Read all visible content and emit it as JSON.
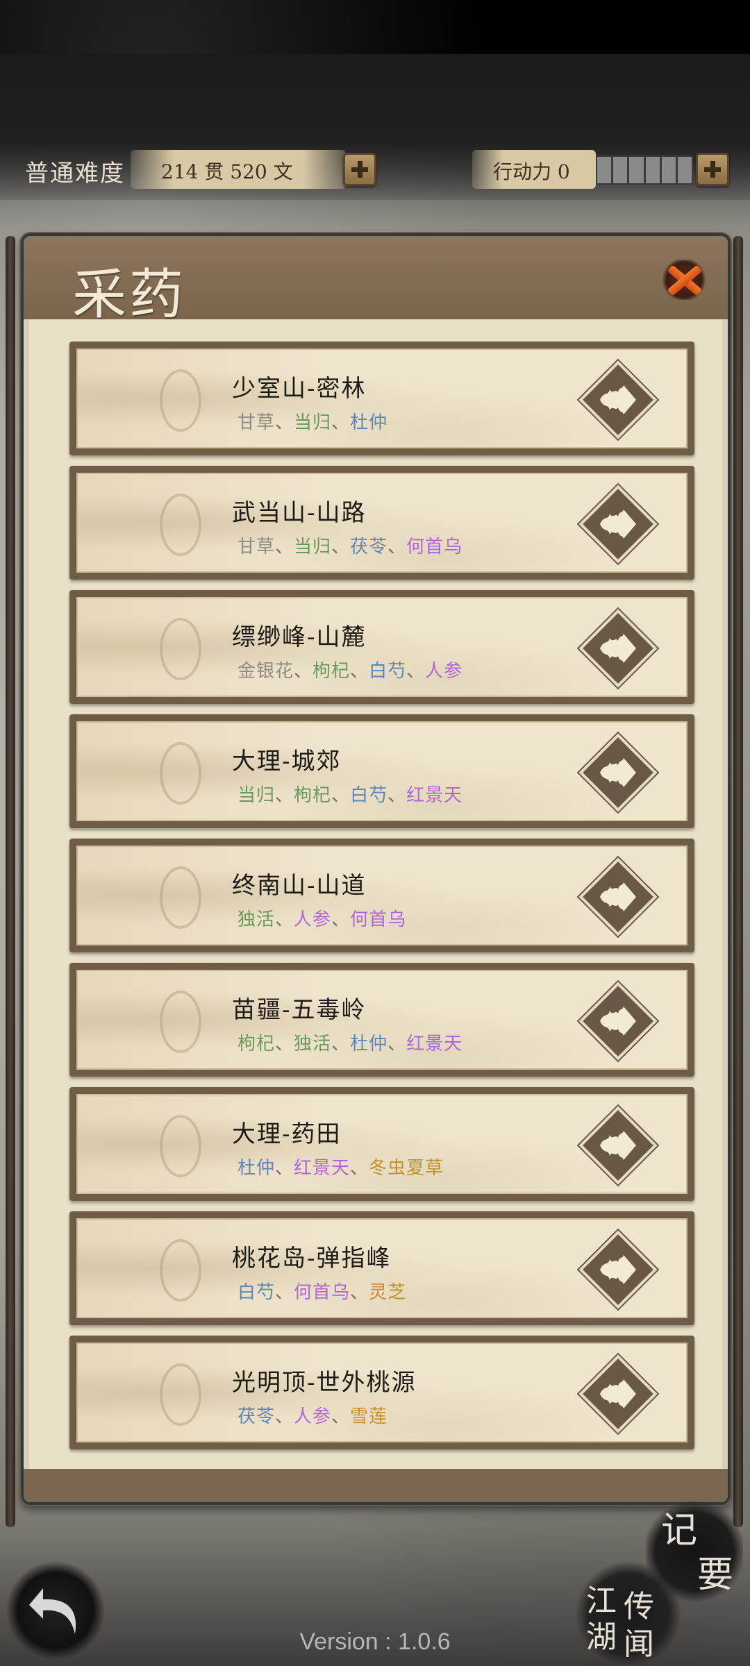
{
  "status": {
    "difficulty": "普通难度",
    "money": "214 贯  520  文",
    "energy": "行动力 0"
  },
  "panel": {
    "title": "采药"
  },
  "herb_colors": {
    "common": "#8f8a82",
    "green": "#6a9a5b",
    "blue": "#5b86b8",
    "purple": "#b065d6",
    "gold": "#c4902a"
  },
  "locations": [
    {
      "name": "少室山-密林",
      "herbs": [
        {
          "t": "甘草",
          "c": "common"
        },
        {
          "t": "当归",
          "c": "green"
        },
        {
          "t": "杜仲",
          "c": "blue"
        }
      ]
    },
    {
      "name": "武当山-山路",
      "herbs": [
        {
          "t": "甘草",
          "c": "common"
        },
        {
          "t": "当归",
          "c": "green"
        },
        {
          "t": "茯苓",
          "c": "blue"
        },
        {
          "t": "何首乌",
          "c": "purple"
        }
      ]
    },
    {
      "name": "缥缈峰-山麓",
      "herbs": [
        {
          "t": "金银花",
          "c": "common"
        },
        {
          "t": "枸杞",
          "c": "green"
        },
        {
          "t": "白芍",
          "c": "blue"
        },
        {
          "t": "人参",
          "c": "purple"
        }
      ]
    },
    {
      "name": "大理-城郊",
      "herbs": [
        {
          "t": "当归",
          "c": "green"
        },
        {
          "t": "枸杞",
          "c": "green"
        },
        {
          "t": "白芍",
          "c": "blue"
        },
        {
          "t": "红景天",
          "c": "purple"
        }
      ]
    },
    {
      "name": "终南山-山道",
      "herbs": [
        {
          "t": "独活",
          "c": "green"
        },
        {
          "t": "人参",
          "c": "purple"
        },
        {
          "t": "何首乌",
          "c": "purple"
        }
      ]
    },
    {
      "name": "苗疆-五毒岭",
      "herbs": [
        {
          "t": "枸杞",
          "c": "green"
        },
        {
          "t": "独活",
          "c": "green"
        },
        {
          "t": "杜仲",
          "c": "blue"
        },
        {
          "t": "红景天",
          "c": "purple"
        }
      ]
    },
    {
      "name": "大理-药田",
      "herbs": [
        {
          "t": "杜仲",
          "c": "blue"
        },
        {
          "t": "红景天",
          "c": "purple"
        },
        {
          "t": "冬虫夏草",
          "c": "gold"
        }
      ]
    },
    {
      "name": "桃花岛-弹指峰",
      "herbs": [
        {
          "t": "白芍",
          "c": "blue"
        },
        {
          "t": "何首乌",
          "c": "purple"
        },
        {
          "t": "灵芝",
          "c": "gold"
        }
      ]
    },
    {
      "name": "光明顶-世外桃源",
      "herbs": [
        {
          "t": "茯苓",
          "c": "blue"
        },
        {
          "t": "人参",
          "c": "purple"
        },
        {
          "t": "雪莲",
          "c": "gold"
        }
      ]
    }
  ],
  "bottom": {
    "jiyao_1": "记",
    "jiyao_2": "要",
    "jh_1": "江",
    "jh_2": "湖",
    "jh_3": "传",
    "jh_4": "闻",
    "version": "Version : 1.0.6"
  }
}
